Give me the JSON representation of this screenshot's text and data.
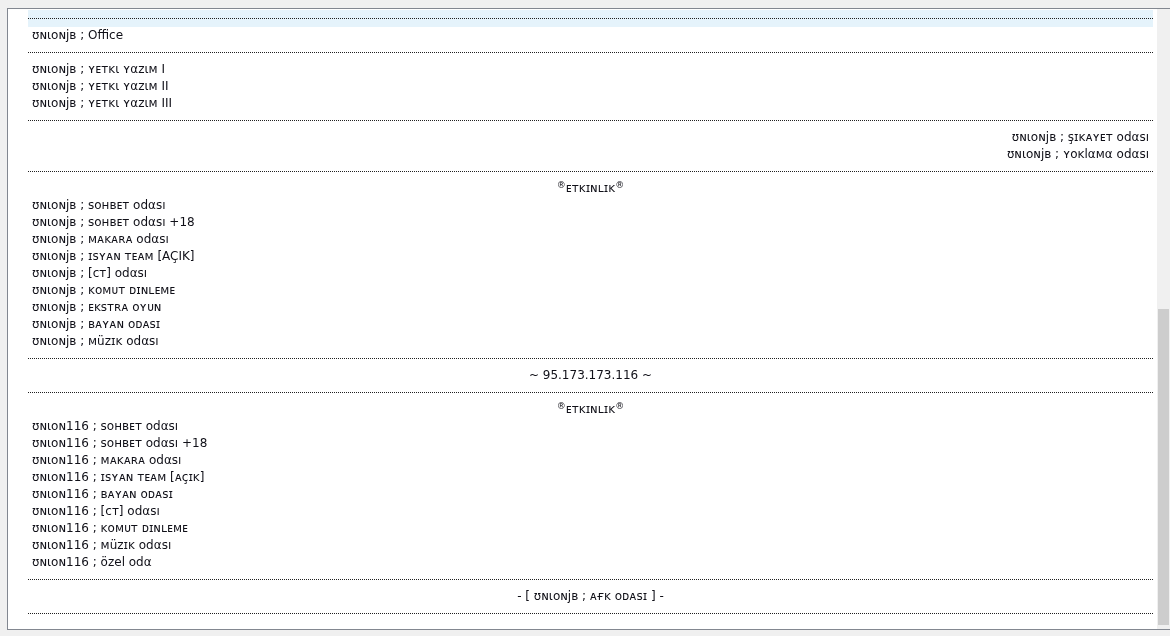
{
  "list": {
    "rows": [
      {
        "kind": "separator",
        "selected": true
      },
      {
        "kind": "entry",
        "text": "ʊɴιᴏɴjʙ ; Office",
        "selected": false
      },
      {
        "kind": "separator",
        "selected": false
      },
      {
        "kind": "entry",
        "text": "ʊɴιᴏɴjʙ ; ʏᴇᴛᴋι ʏαᴢιᴍ I",
        "selected": false
      },
      {
        "kind": "entry",
        "text": "ʊɴιᴏɴjʙ ; ʏᴇᴛᴋι ʏαᴢιᴍ II",
        "selected": false
      },
      {
        "kind": "entry",
        "text": "ʊɴιᴏɴjʙ ; ʏᴇᴛᴋι ʏαᴢιᴍ III",
        "selected": false
      },
      {
        "kind": "separator",
        "selected": false
      },
      {
        "kind": "aside",
        "text": "ʊɴιᴏɴjʙ ; şɪᴋᴀʏᴇᴛ odαsı",
        "selected": false
      },
      {
        "kind": "aside",
        "text": "ʊɴιᴏɴjʙ ; ʏᴏᴋlαᴍα odαsı",
        "selected": false
      },
      {
        "kind": "separator",
        "selected": false
      },
      {
        "kind": "heading",
        "text": "$^{®}$ᴇᴛᴋɪɴʟɪᴋ$^{®}$",
        "selected": false
      },
      {
        "kind": "entry",
        "text": "ʊɴιᴏɴjʙ ; sᴏʜʙᴇᴛ odαsı",
        "selected": false
      },
      {
        "kind": "entry",
        "text": "ʊɴιᴏɴjʙ ; sᴏʜʙᴇᴛ odαsı +18",
        "selected": false
      },
      {
        "kind": "entry",
        "text": "ʊɴιᴏɴjʙ ; ᴍᴀᴋᴀʀᴀ odαsı",
        "selected": false
      },
      {
        "kind": "entry",
        "text": "ʊɴιᴏɴjʙ ; ɪsʏᴀɴ ᴛᴇᴀᴍ [AÇIK]",
        "selected": false
      },
      {
        "kind": "entry",
        "text": "ʊɴιᴏɴjʙ ; [ᴄᴛ] odαsı",
        "selected": false
      },
      {
        "kind": "entry",
        "text": "ʊɴιᴏɴjʙ ; ᴋᴏᴍᴜᴛ ᴅɪɴʟᴇᴍᴇ",
        "selected": false
      },
      {
        "kind": "entry",
        "text": "ʊɴιᴏɴjʙ ; ᴇᴋsᴛʀᴀ ᴏʏᴜɴ",
        "selected": false
      },
      {
        "kind": "entry",
        "text": "ʊɴιᴏɴjʙ ; ʙᴀʏᴀɴ ᴏᴅᴀsɪ",
        "selected": false
      },
      {
        "kind": "entry",
        "text": "ʊɴιᴏɴjʙ ; ᴍüᴢɪᴋ odαsı",
        "selected": false
      },
      {
        "kind": "separator",
        "selected": false
      },
      {
        "kind": "heading",
        "text": "~ 95.173.173.116 ~",
        "selected": false
      },
      {
        "kind": "separator",
        "selected": false
      },
      {
        "kind": "heading",
        "text": "$^{®}$ᴇᴛᴋɪɴʟɪᴋ$^{®}$",
        "selected": false
      },
      {
        "kind": "entry",
        "text": "ʊɴιᴏɴ116 ; sᴏʜʙᴇᴛ odαsı",
        "selected": false
      },
      {
        "kind": "entry",
        "text": "ʊɴιᴏɴ116 ; sᴏʜʙᴇᴛ odαsı +18",
        "selected": false
      },
      {
        "kind": "entry",
        "text": "ʊɴιᴏɴ116 ; ᴍᴀᴋᴀʀᴀ odαsı",
        "selected": false
      },
      {
        "kind": "entry",
        "text": "ʊɴιᴏɴ116 ; ɪsʏᴀɴ ᴛᴇᴀᴍ [ᴀçɪᴋ]",
        "selected": false
      },
      {
        "kind": "entry",
        "text": "ʊɴιᴏɴ116 ; ʙᴀʏᴀɴ ᴏᴅᴀsɪ",
        "selected": false
      },
      {
        "kind": "entry",
        "text": "ʊɴιᴏɴ116 ; [ᴄᴛ] odαsı",
        "selected": false
      },
      {
        "kind": "entry",
        "text": "ʊɴιᴏɴ116 ; ᴋᴏᴍᴜᴛ ᴅɪɴʟᴇᴍᴇ",
        "selected": false
      },
      {
        "kind": "entry",
        "text": "ʊɴιᴏɴ116 ; ᴍüᴢɪᴋ odαsı",
        "selected": false
      },
      {
        "kind": "entry",
        "text": "ʊɴιᴏɴ116 ; özel odα",
        "selected": false
      },
      {
        "kind": "separator",
        "selected": false
      },
      {
        "kind": "heading",
        "text": "- [ ʊɴιᴏɴjʙ ; ᴀғᴋ ᴏᴅᴀsɪ ] -",
        "selected": false
      },
      {
        "kind": "separator",
        "selected": false
      }
    ]
  }
}
